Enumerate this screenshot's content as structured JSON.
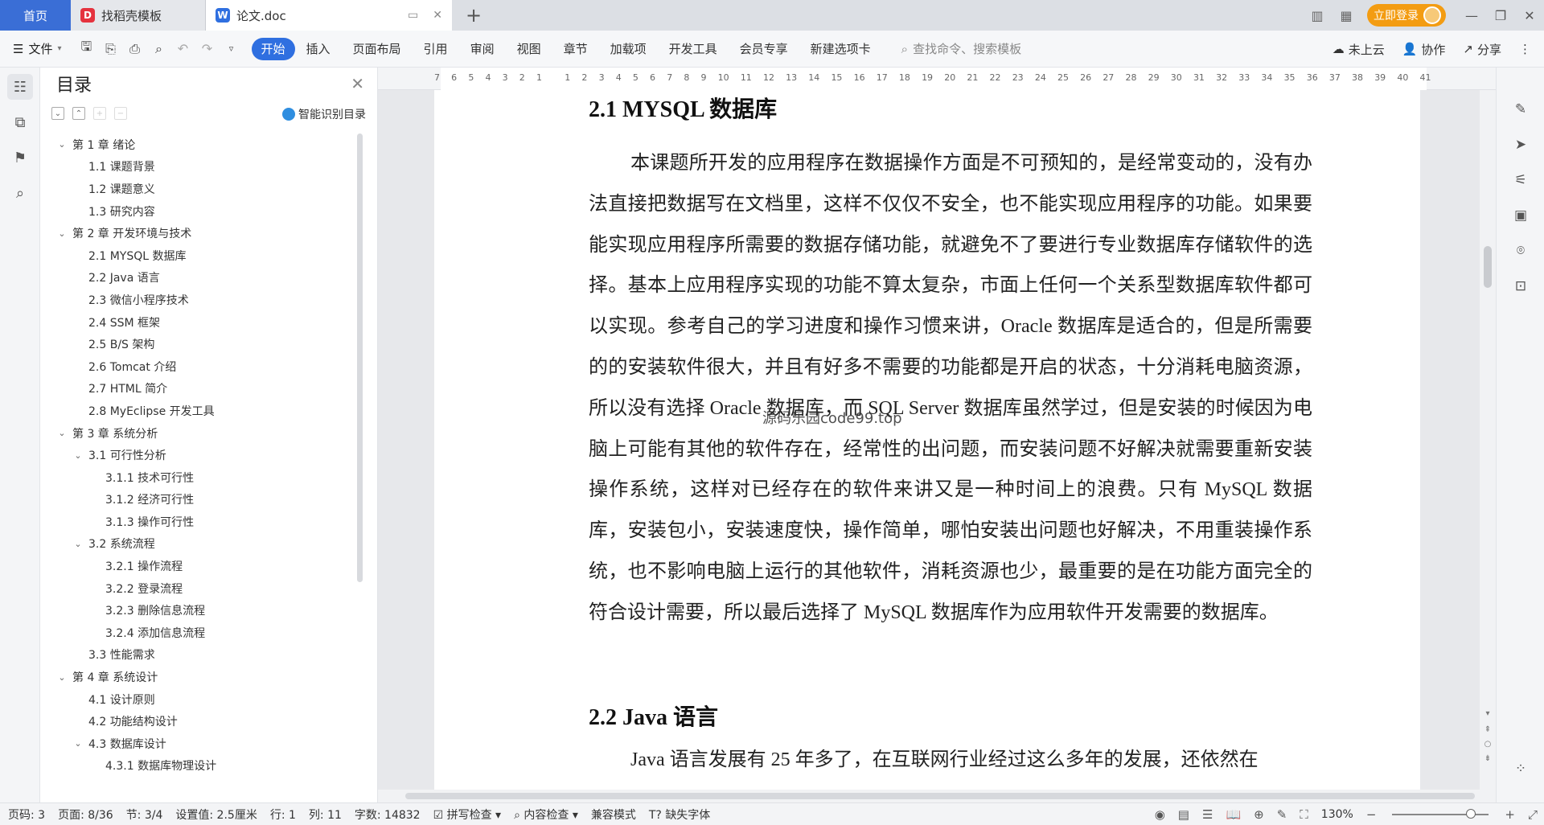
{
  "titlebar": {
    "home_tab": "首页",
    "tab1_label": "找稻壳模板",
    "tab2_label": "论文.doc",
    "login_label": "立即登录"
  },
  "menubar": {
    "file_label": "文件",
    "tabs": [
      "开始",
      "插入",
      "页面布局",
      "引用",
      "审阅",
      "视图",
      "章节",
      "加载项",
      "开发工具",
      "会员专享",
      "新建选项卡"
    ],
    "search_placeholder": "查找命令、搜索模板",
    "cloud_label": "未上云",
    "collab_label": "协作",
    "share_label": "分享"
  },
  "toc": {
    "title": "目录",
    "smart_label": "智能识别目录",
    "items": [
      {
        "level": 1,
        "label": "第 1 章  绪论",
        "expanded": true
      },
      {
        "level": 2,
        "label": "1.1  课题背景"
      },
      {
        "level": 2,
        "label": "1.2  课题意义"
      },
      {
        "level": 2,
        "label": "1.3  研究内容"
      },
      {
        "level": 1,
        "label": "第 2 章  开发环境与技术",
        "expanded": true
      },
      {
        "level": 2,
        "label": "2.1  MYSQL 数据库"
      },
      {
        "level": 2,
        "label": "2.2 Java 语言"
      },
      {
        "level": 2,
        "label": "2.3  微信小程序技术"
      },
      {
        "level": 2,
        "label": "2.4 SSM 框架"
      },
      {
        "level": 2,
        "label": "2.5 B/S 架构"
      },
      {
        "level": 2,
        "label": "2.6 Tomcat  介绍"
      },
      {
        "level": 2,
        "label": "2.7 HTML 简介"
      },
      {
        "level": 2,
        "label": "2.8 MyEclipse 开发工具"
      },
      {
        "level": 1,
        "label": "第 3 章  系统分析",
        "expanded": true
      },
      {
        "level": 2,
        "label": "3.1  可行性分析",
        "expanded": true
      },
      {
        "level": 3,
        "label": "3.1.1  技术可行性"
      },
      {
        "level": 3,
        "label": "3.1.2  经济可行性"
      },
      {
        "level": 3,
        "label": "3.1.3  操作可行性"
      },
      {
        "level": 2,
        "label": "3.2  系统流程",
        "expanded": true
      },
      {
        "level": 3,
        "label": "3.2.1  操作流程"
      },
      {
        "level": 3,
        "label": "3.2.2  登录流程"
      },
      {
        "level": 3,
        "label": "3.2.3  删除信息流程"
      },
      {
        "level": 3,
        "label": "3.2.4  添加信息流程"
      },
      {
        "level": 2,
        "label": "3.3  性能需求"
      },
      {
        "level": 1,
        "label": "第 4 章  系统设计",
        "expanded": true
      },
      {
        "level": 2,
        "label": "4.1  设计原则"
      },
      {
        "level": 2,
        "label": "4.2  功能结构设计"
      },
      {
        "level": 2,
        "label": "4.3  数据库设计",
        "expanded": true
      },
      {
        "level": 3,
        "label": "4.3.1  数据库物理设计"
      }
    ]
  },
  "ruler": {
    "ticks": [
      "7",
      "6",
      "5",
      "4",
      "3",
      "2",
      "1",
      "",
      "1",
      "2",
      "3",
      "4",
      "5",
      "6",
      "7",
      "8",
      "9",
      "10",
      "11",
      "12",
      "13",
      "14",
      "15",
      "16",
      "17",
      "18",
      "19",
      "20",
      "21",
      "22",
      "23",
      "24",
      "25",
      "26",
      "27",
      "28",
      "29",
      "30",
      "31",
      "32",
      "33",
      "34",
      "35",
      "36",
      "37",
      "38",
      "39",
      "40",
      "41"
    ]
  },
  "document": {
    "heading1": "2.1 MYSQL 数据库",
    "paragraph1": "本课题所开发的应用程序在数据操作方面是不可预知的，是经常变动的，没有办法直接把数据写在文档里，这样不仅仅不安全，也不能实现应用程序的功能。如果要能实现应用程序所需要的数据存储功能，就避免不了要进行专业数据库存储软件的选择。基本上应用程序实现的功能不算太复杂，市面上任何一个关系型数据库软件都可以实现。参考自己的学习进度和操作习惯来讲，Oracle 数据库是适合的，但是所需要的的安装软件很大，并且有好多不需要的功能都是开启的状态，十分消耗电脑资源，所以没有选择 Oracle 数据库，而 SQL Server 数据库虽然学过，但是安装的时候因为电脑上可能有其他的软件存在，经常性的出问题，而安装问题不好解决就需要重新安装操作系统，这样对已经存在的软件来讲又是一种时间上的浪费。只有 MySQL 数据库，安装包小，安装速度快，操作简单，哪怕安装出问题也好解决，不用重装操作系统，也不影响电脑上运行的其他软件，消耗资源也少，最重要的是在功能方面完全的符合设计需要，所以最后选择了 MySQL 数据库作为应用软件开发需要的数据库。",
    "heading2": "2.2 Java 语言",
    "paragraph2": "Java 语言发展有 25 年多了，在互联网行业经过这么多年的发展，还依然在",
    "watermark": "源码乐园code99.top"
  },
  "statusbar": {
    "page_code": "页码: 3",
    "page": "页面: 8/36",
    "section": "节: 3/4",
    "setting": "设置值: 2.5厘米",
    "row": "行: 1",
    "col": "列: 11",
    "wordcount": "字数: 14832",
    "spellcheck": "拼写检查",
    "contentcheck": "内容检查",
    "compat": "兼容模式",
    "missing_font": "缺失字体",
    "zoom": "130%"
  },
  "colors": {
    "accent": "#2f6fe0",
    "home_tab": "#3a6ed6",
    "login": "#f39c12"
  }
}
